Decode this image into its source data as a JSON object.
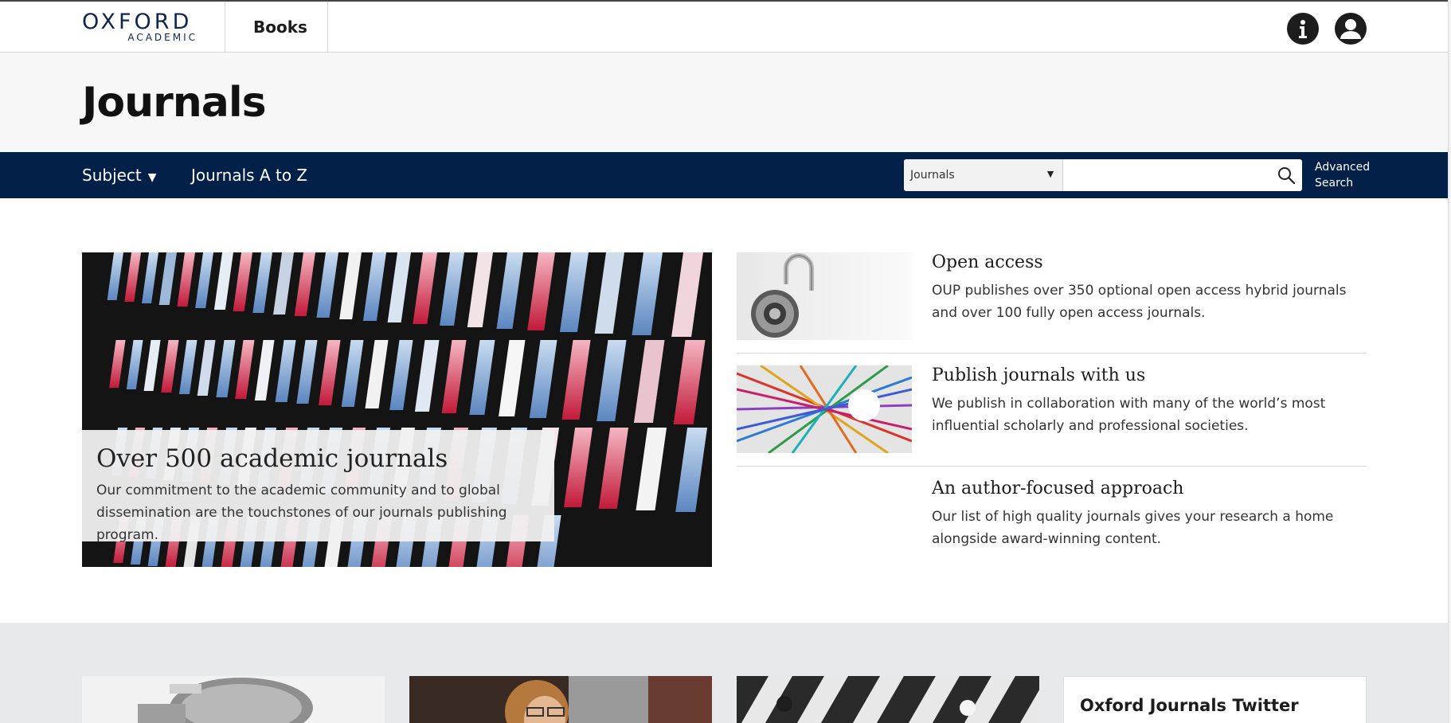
{
  "header": {
    "logo_top": "OXFORD",
    "logo_bottom": "ACADEMIC",
    "books_label": "Books",
    "info_icon": "info-icon",
    "account_icon": "user-account-icon"
  },
  "title_band": {
    "title": "Journals"
  },
  "nav": {
    "subject_label": "Subject",
    "az_label": "Journals A to Z",
    "search_scope": "Journals",
    "search_value": "",
    "advanced_line1": "Advanced",
    "advanced_line2": "Search"
  },
  "hero": {
    "heading": "Over 500 academic journals",
    "body": "Our commitment to the academic community and to global dissemination are the touchstones of our journals publishing program."
  },
  "features": [
    {
      "title": "Open access",
      "body": "OUP publishes over 350 optional open access hybrid journals and over 100 fully open access journals."
    },
    {
      "title": "Publish journals with us",
      "body": "We publish in collaboration with many of the world’s most influential scholarly and professional societies."
    },
    {
      "title": "An author-focused approach",
      "body": "Our list of high quality journals gives your research a home alongside award-winning content."
    }
  ],
  "lower": {
    "twitter_title": "Oxford Journals Twitter"
  },
  "colors": {
    "nav_bg": "#022048",
    "logo_color": "#0f2550",
    "title_band_bg": "#f7f7f7",
    "lower_band_bg": "#e8e9ec"
  }
}
